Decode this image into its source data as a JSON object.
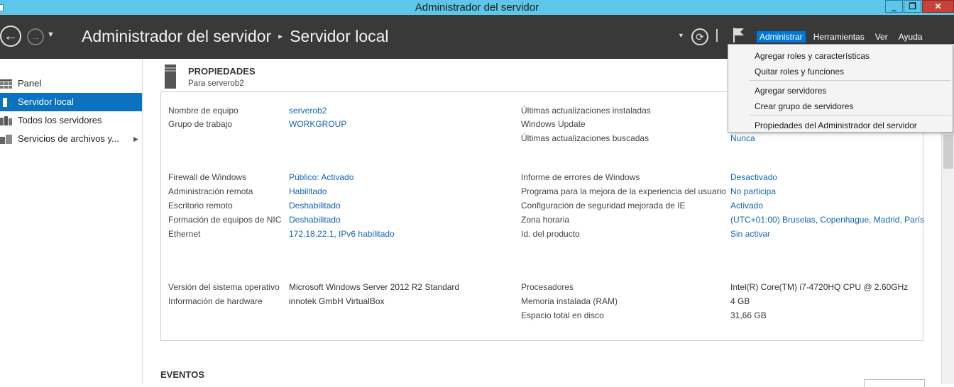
{
  "window": {
    "title": "Administrador del servidor",
    "minimize": "‗",
    "restore": "❐",
    "close": "✕"
  },
  "header": {
    "crumb_root": "Administrador del servidor",
    "crumb_sep": "▸",
    "crumb_current": "Servidor local",
    "menu": [
      "Administrar",
      "Herramientas",
      "Ver",
      "Ayuda"
    ],
    "active_menu": "Administrar"
  },
  "sidebar": {
    "items": [
      {
        "label": "Panel",
        "icon": "dashboard-icon"
      },
      {
        "label": "Servidor local",
        "icon": "local-server-icon",
        "selected": true
      },
      {
        "label": "Todos los servidores",
        "icon": "all-servers-icon"
      },
      {
        "label": "Servicios de archivos y...",
        "icon": "file-services-icon",
        "has_arrow": true
      }
    ]
  },
  "properties": {
    "title": "PROPIEDADES",
    "subtitle": "Para serverob2",
    "left": [
      {
        "label": "Nombre de equipo",
        "value": "serverob2",
        "link": true
      },
      {
        "label": "Grupo de trabajo",
        "value": "WORKGROUP",
        "link": true
      },
      {
        "label": "Firewall de Windows",
        "value": "Público: Activado",
        "link": true
      },
      {
        "label": "Administración remota",
        "value": "Habilitado",
        "link": true
      },
      {
        "label": "Escritorio remoto",
        "value": "Deshabilitado",
        "link": true
      },
      {
        "label": "Formación de equipos de NIC",
        "value": "Deshabilitado",
        "link": true
      },
      {
        "label": "Ethernet",
        "value": "172.18.22.1, IPv6 habilitado",
        "link": true
      },
      {
        "label": "Versión del sistema operativo",
        "value": "Microsoft Windows Server 2012 R2 Standard",
        "link": false
      },
      {
        "label": "Información de hardware",
        "value": "innotek GmbH VirtualBox",
        "link": false
      }
    ],
    "right": [
      {
        "label": "Últimas actualizaciones instaladas",
        "value": "",
        "link": true
      },
      {
        "label": "Windows Update",
        "value": "",
        "link": true
      },
      {
        "label": "Últimas actualizaciones buscadas",
        "value": "Nunca",
        "link": true
      },
      {
        "label": "Informe de errores de Windows",
        "value": "Desactivado",
        "link": true
      },
      {
        "label": "Programa para la mejora de la experiencia del usuario",
        "value": "No participa",
        "link": true
      },
      {
        "label": "Configuración de seguridad mejorada de IE",
        "value": "Activado",
        "link": true
      },
      {
        "label": "Zona horaria",
        "value": "(UTC+01:00) Bruselas, Copenhague, Madrid, París",
        "link": true
      },
      {
        "label": "Id. del producto",
        "value": "Sin activar",
        "link": true
      },
      {
        "label": "Procesadores",
        "value": "Intel(R) Core(TM) i7-4720HQ CPU @ 2.60GHz",
        "link": false
      },
      {
        "label": "Memoria instalada (RAM)",
        "value": "4 GB",
        "link": false
      },
      {
        "label": "Espacio total en disco",
        "value": "31,66 GB",
        "link": false
      }
    ]
  },
  "events": {
    "title": "EVENTOS"
  },
  "dropdown": {
    "items": [
      "Agregar roles y características",
      "Quitar roles y funciones",
      "Agregar servidores",
      "Crear grupo de servidores",
      "Propiedades del Administrador del servidor"
    ]
  },
  "colors": {
    "titlebar": "#5ec6e8",
    "header": "#393939",
    "selection": "#0a72bf",
    "link": "#1466b8",
    "menu_active": "#0078d7"
  }
}
